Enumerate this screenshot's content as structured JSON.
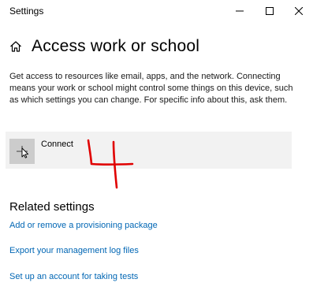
{
  "window": {
    "title": "Settings",
    "controls": {
      "minimize_icon": "minimize-icon",
      "maximize_icon": "maximize-icon",
      "close_icon": "close-icon"
    }
  },
  "header": {
    "icon": "home-icon",
    "title": "Access work or school"
  },
  "description": "Get access to resources like email, apps, and the network. Connecting means your work or school might control some things on this device, such as which settings you can change. For specific info about this, ask them.",
  "connect": {
    "icon": "plus-icon",
    "label": "Connect"
  },
  "annotation": {
    "text": "4",
    "color": "#e00000"
  },
  "related_settings": {
    "heading": "Related settings",
    "links": [
      "Add or remove a provisioning package",
      "Export your management log files",
      "Set up an account for taking tests"
    ]
  },
  "colors": {
    "link": "#0066b4",
    "tile_bg": "#f2f2f2",
    "icon_box_bg": "#cccccc",
    "annotation": "#e00000"
  }
}
